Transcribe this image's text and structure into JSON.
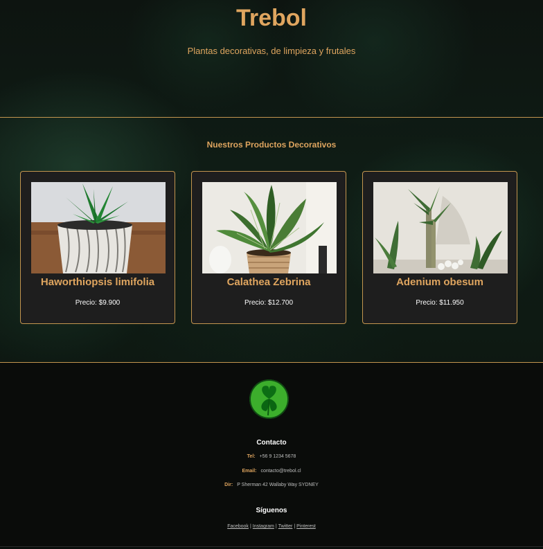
{
  "header": {
    "title": "Trebol",
    "subtitle": "Plantas decorativas, de limpieza y frutales"
  },
  "products": {
    "heading": "Nuestros Productos Decorativos",
    "items": [
      {
        "name": "Haworthiopsis limifolia",
        "price": "Precio: $9.900"
      },
      {
        "name": "Calathea Zebrina",
        "price": "Precio: $12.700"
      },
      {
        "name": "Adenium obesum",
        "price": "Precio: $11.950"
      }
    ]
  },
  "footer": {
    "contact_title": "Contacto",
    "tel_label": "Tel:",
    "tel_value": "+56 9 1234 5678",
    "email_label": "Email:",
    "email_value": "contacto@trebol.cl",
    "dir_label": "Dir:",
    "dir_value": "P Sherman 42 Wallaby Way SYDNEY",
    "follow_title": "Síguenos",
    "social": [
      "Facebook",
      "Instagram",
      "Twitter",
      "Pinterest"
    ],
    "separator": "|"
  },
  "colors": {
    "accent": "#dfa55f",
    "card_bg": "#1e1e1e",
    "border": "#c4964f"
  }
}
